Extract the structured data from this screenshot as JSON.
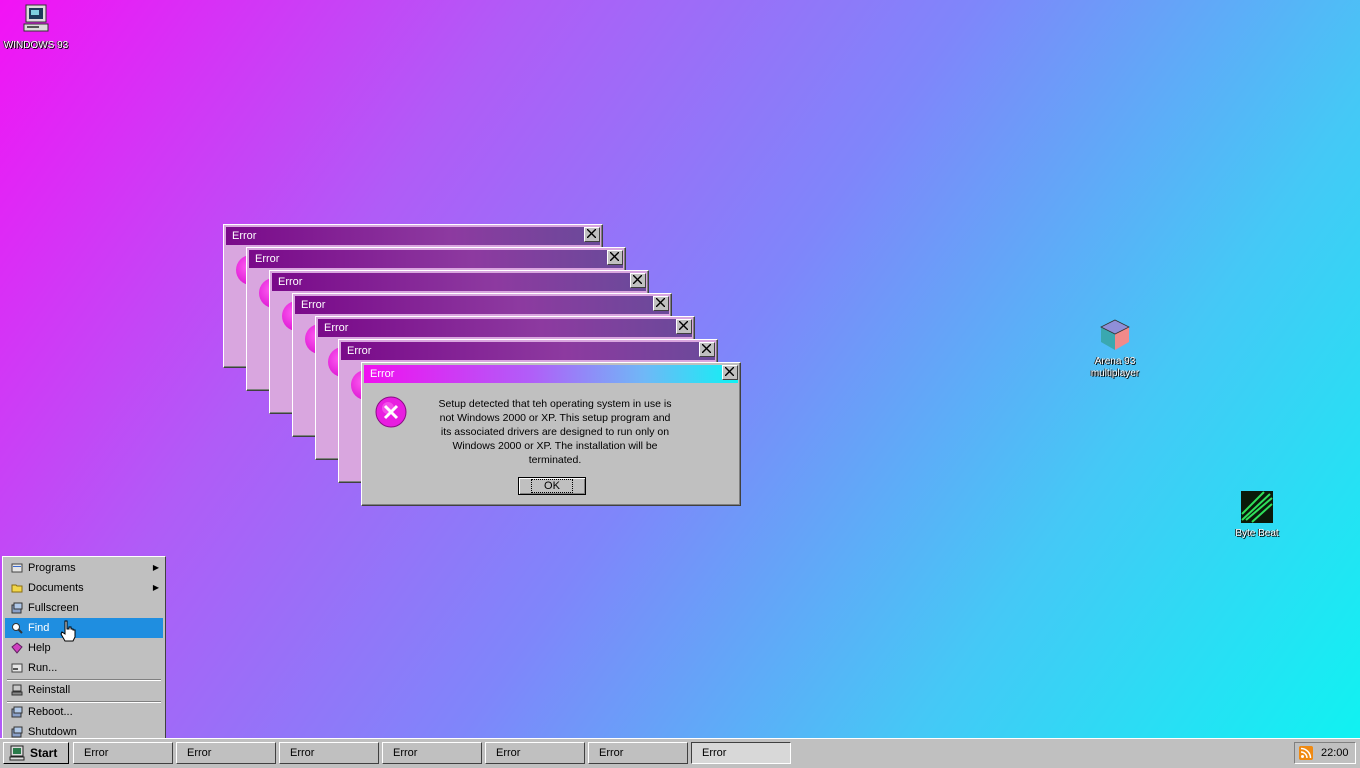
{
  "desktop": {
    "icons": [
      {
        "label": "WINDOWS 93",
        "icon": "computer-icon"
      },
      {
        "label": "Arena 93\nmultiplayer",
        "icon": "cube-icon"
      },
      {
        "label": "Byte Beat",
        "icon": "bytebeat-icon"
      }
    ]
  },
  "dialogs": {
    "title": "Error",
    "message": "Setup detected that teh operating system in use is\nnot Windows 2000 or XP. This setup program and\nits associated drivers are designed to run only on\nWindows 2000 or XP. The installation will be\nterminated.",
    "ok_label": "OK",
    "icon": "error-icon"
  },
  "start_menu": {
    "items": [
      {
        "label": "Programs",
        "icon": "programs-icon",
        "submenu": true
      },
      {
        "label": "Documents",
        "icon": "documents-icon",
        "submenu": true
      },
      {
        "label": "Fullscreen",
        "icon": "fullscreen-icon"
      },
      {
        "label": "Find",
        "icon": "find-icon",
        "selected": true
      },
      {
        "label": "Help",
        "icon": "help-icon"
      },
      {
        "label": "Run...",
        "icon": "run-icon"
      },
      {
        "label": "Reinstall",
        "icon": "reinstall-icon"
      },
      {
        "label": "Reboot...",
        "icon": "reboot-icon"
      },
      {
        "label": "Shutdown",
        "icon": "shutdown-icon"
      }
    ]
  },
  "taskbar": {
    "start_label": "Start",
    "tasks": [
      "Error",
      "Error",
      "Error",
      "Error",
      "Error",
      "Error",
      "Error"
    ],
    "clock": "22:00"
  },
  "colors": {
    "selection": "#1f8ee0",
    "error_icon": "#e81ee0"
  }
}
